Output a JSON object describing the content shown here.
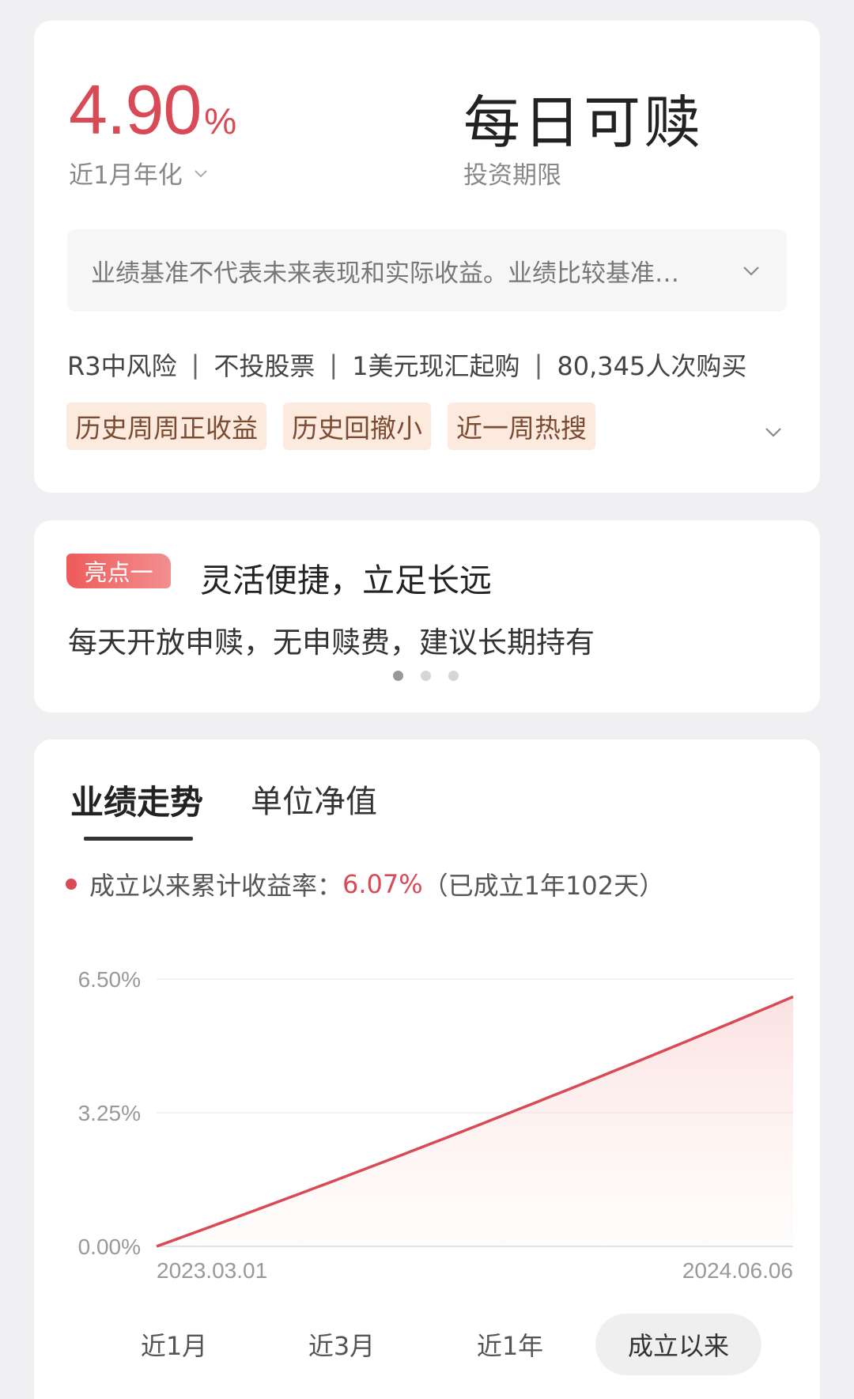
{
  "summary": {
    "rate_value": "4.90",
    "rate_unit": "%",
    "rate_label": "近1月年化",
    "term_value": "每日可赎",
    "term_label": "投资期限",
    "notice": "业绩基准不代表未来表现和实际收益。业绩比较基准…",
    "meta": [
      "R3中风险",
      "不投股票",
      "1美元现汇起购",
      "80,345人次购买"
    ],
    "meta_separator": "|",
    "tags": [
      "历史周周正收益",
      "历史回撤小",
      "近一周热搜"
    ]
  },
  "highlight": {
    "badge": "亮点一",
    "title": "灵活便捷，立足长远",
    "description": "每天开放申赎，无申赎费，建议长期持有",
    "page_count": 3,
    "active_page": 0
  },
  "performance": {
    "tabs": [
      "业绩走势",
      "单位净值"
    ],
    "active_tab": 0,
    "legend_label": "成立以来累计收益率：",
    "legend_value": "6.07%",
    "legend_suffix": "（已成立1年102天）",
    "ranges": [
      "近1月",
      "近3月",
      "近1年",
      "成立以来"
    ],
    "active_range": 3
  },
  "colors": {
    "accent": "#d84a55",
    "tag_bg": "#fdeadf",
    "tag_text": "#7a4c33"
  },
  "chart_data": {
    "type": "area",
    "title": "",
    "xlabel": "",
    "ylabel": "",
    "x": [
      "2023.03.01",
      "2024.06.06"
    ],
    "series": [
      {
        "values": [
          0.0,
          6.07
        ]
      }
    ],
    "y_ticks": [
      "0.00%",
      "3.25%",
      "6.50%"
    ],
    "x_tick_labels": [
      "2023.03.01",
      "2024.06.06"
    ],
    "ylim": [
      0,
      6.5
    ],
    "grid": true
  }
}
